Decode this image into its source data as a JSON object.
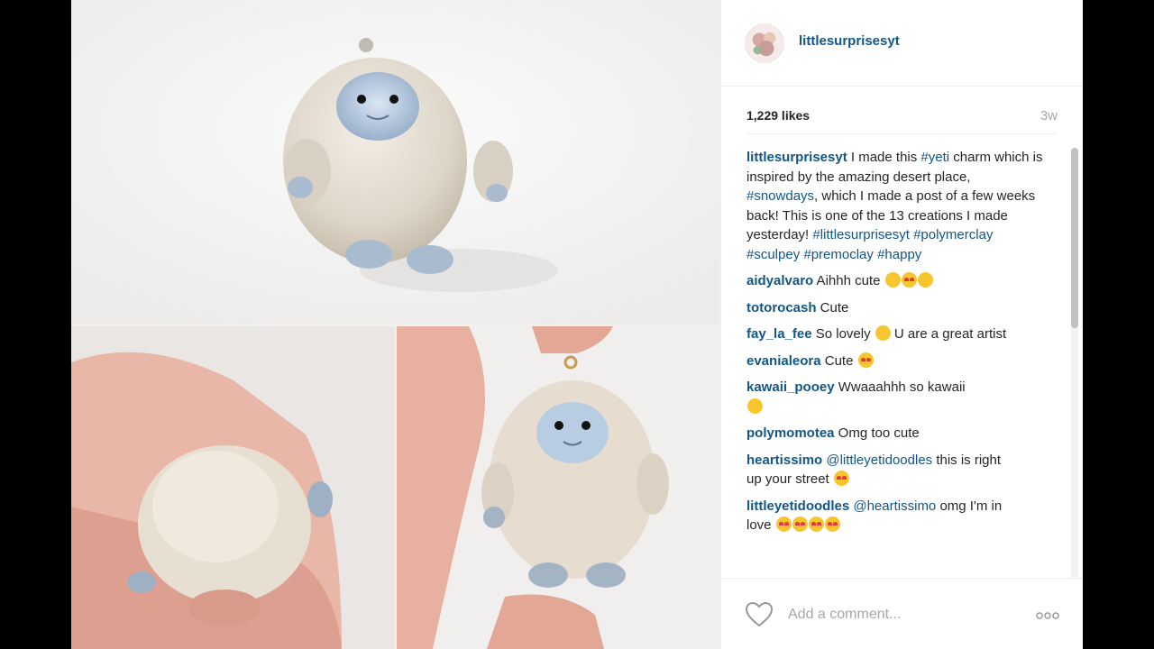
{
  "post": {
    "username": "littlesurprisesyt",
    "likes": "1,229 likes",
    "age": "3w"
  },
  "caption": {
    "username": "littlesurprisesyt",
    "text1": " I made this ",
    "tag1": "#yeti",
    "text2": " charm which is inspired by the amazing desert place, ",
    "tag2": "#snowdays",
    "text3": ", which I made a post of a few weeks back! This is one of the 13 creations I made yesterday! ",
    "tags": "#littlesurprisesyt #polymerclay #sculpey #premoclay #happy"
  },
  "comments": [
    {
      "user": "aidyalvaro",
      "text": " Aihhh cute",
      "emojis": 3
    },
    {
      "user": "totorocash",
      "text": " Cute",
      "emojis": 0
    },
    {
      "user": "fay_la_fee",
      "text": " So lovely ",
      "after": " U are a great artist",
      "emojis": 1
    },
    {
      "user": "evanialeora",
      "text": " Cute ",
      "emojis": 1
    },
    {
      "user": "kawaii_pooey",
      "text": " Wwaaahhh so kawaii ",
      "emojis": 1
    },
    {
      "user": "polymomotea",
      "text": " Omg too cute",
      "emojis": 0
    },
    {
      "user": "heartissimo",
      "mention": "@littleyetidoodles",
      "text": " this is right up your street ",
      "emojis": 1
    },
    {
      "user": "littleyetidoodles",
      "mention": "@heartissimo",
      "text": " omg I'm in love ",
      "emojis": 4
    }
  ],
  "composer": {
    "placeholder": "Add a comment...",
    "like_icon": "heart-outline-icon",
    "more_icon": "ellipsis-icon"
  },
  "colors": {
    "link": "#125688",
    "muted": "#a5a7aa",
    "text": "#262626"
  }
}
